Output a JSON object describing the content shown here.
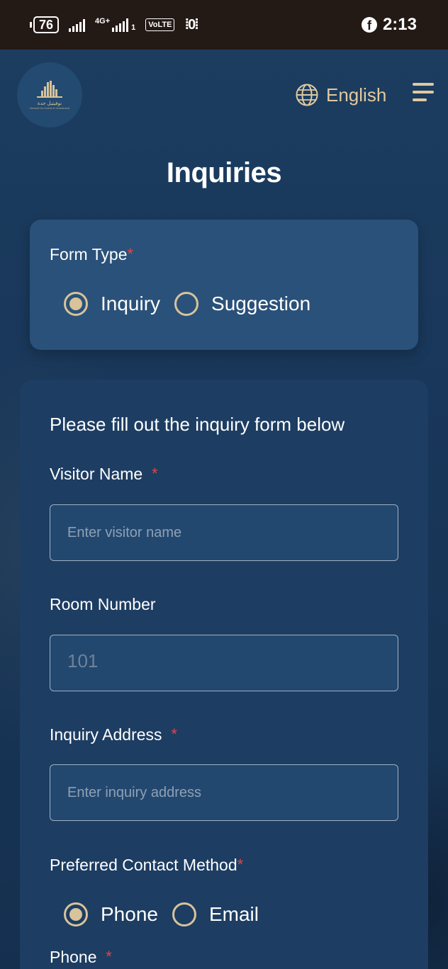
{
  "status_bar": {
    "battery": "76",
    "network": "4G+",
    "sim": "1",
    "volte": "VoLTE",
    "vibrate": "⁞0⁞",
    "time": "2:13"
  },
  "header": {
    "logo_text": "نوفيتيل جدة",
    "logo_subtext": "Novotel for Hotels & Investment",
    "language_label": "English",
    "page_title": "Inquiries"
  },
  "form_type": {
    "label": "Form Type",
    "required_mark": "*",
    "options": [
      "Inquiry",
      "Suggestion"
    ],
    "selected": "Inquiry"
  },
  "form": {
    "intro": "Please fill out the inquiry form below",
    "visitor_name": {
      "label": "Visitor Name",
      "required_mark": "*",
      "placeholder": "Enter visitor name"
    },
    "room_number": {
      "label": "Room Number",
      "placeholder": "101"
    },
    "inquiry_address": {
      "label": "Inquiry Address",
      "required_mark": "*",
      "placeholder": "Enter inquiry address"
    },
    "contact_method": {
      "label": "Preferred Contact Method",
      "required_mark": "*",
      "options": [
        "Phone",
        "Email"
      ],
      "selected": "Phone"
    },
    "phone": {
      "label": "Phone",
      "required_mark": "*"
    }
  },
  "colors": {
    "accent": "#d8c39a",
    "background": "#1c3e60",
    "card": "#2a5179",
    "required": "#e04848"
  }
}
